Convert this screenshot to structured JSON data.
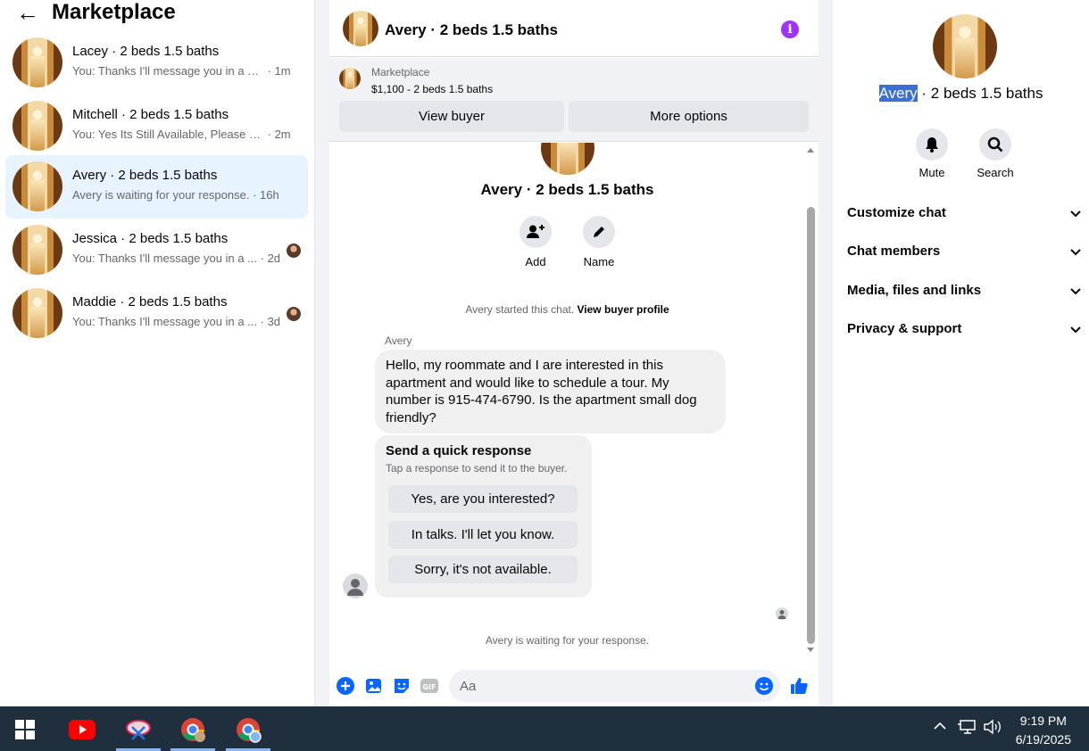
{
  "left": {
    "back_glyph": "←",
    "title": "Marketplace",
    "conversations": [
      {
        "name": "Lacey · 2 beds 1.5 baths",
        "snippet": "You: Thanks I'll message you in a mo...",
        "time": "· 1m",
        "active": false,
        "read_avatar": false
      },
      {
        "name": "Mitchell · 2 beds 1.5 baths",
        "snippet": "You: Yes Its Still Available, Please Sen...",
        "time": "· 2m",
        "active": false,
        "read_avatar": false
      },
      {
        "name": "Avery · 2 beds 1.5 baths",
        "snippet": "Avery is waiting for your response.",
        "time": "· 16h",
        "active": true,
        "read_avatar": false
      },
      {
        "name": "Jessica · 2 beds 1.5 baths",
        "snippet": "You: Thanks I'll message you in a ...",
        "time": "· 2d",
        "active": false,
        "read_avatar": true
      },
      {
        "name": "Maddie · 2 beds 1.5 baths",
        "snippet": "You: Thanks I'll message you in a ...",
        "time": "· 3d",
        "active": false,
        "read_avatar": true
      }
    ]
  },
  "chat": {
    "title": "Avery · 2 beds 1.5 baths",
    "info_icon": "i",
    "marketplace_label": "Marketplace",
    "listing": "$1,100 - 2 beds 1.5 baths",
    "view_buyer": "View buyer",
    "more_options": "More options",
    "contact_name": "Avery · 2 beds 1.5 baths",
    "add_label": "Add",
    "name_label": "Name",
    "started_text": "Avery started this chat.",
    "view_profile": "View buyer profile",
    "sender": "Avery",
    "message": "Hello, my roommate and I are interested in this apartment and would like to schedule a tour. My number is 915-474-6790. Is the apartment small dog friendly?",
    "quick_title": "Send a quick response",
    "quick_sub": "Tap a response to send it to the buyer.",
    "quick_responses": [
      "Yes, are you interested?",
      "In talks. I'll let you know.",
      "Sorry, it's not available."
    ],
    "waiting": "Avery is waiting for your response.",
    "composer_placeholder": "Aa"
  },
  "right": {
    "name_highlight": "Avery",
    "name_rest": " · 2 beds 1.5 baths",
    "mute": "Mute",
    "search": "Search",
    "sections": [
      "Customize chat",
      "Chat members",
      "Media, files and links",
      "Privacy & support"
    ]
  },
  "taskbar": {
    "time": "9:19 PM",
    "date": "6/19/2025"
  },
  "colors": {
    "accent": "#0866ff",
    "info": "#a033ff",
    "active_row": "#e7f3ff",
    "taskbar": "#1f2f3d"
  }
}
